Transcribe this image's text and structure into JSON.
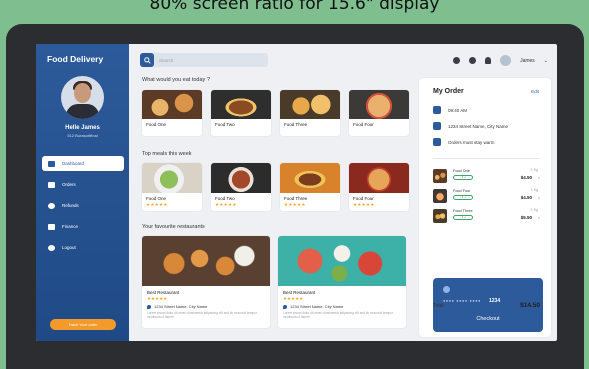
{
  "caption": "80% screen ratio for 15.6\" display",
  "sidebar": {
    "brand": "Food Delivery",
    "user_name": "Helle James",
    "user_sub": "512 Burasortfinal",
    "nav": [
      {
        "label": "Dashboard",
        "icon": "dashboard-icon"
      },
      {
        "label": "Orders",
        "icon": "orders-icon"
      },
      {
        "label": "Refunds",
        "icon": "refunds-icon"
      },
      {
        "label": "Finance",
        "icon": "finance-icon"
      },
      {
        "label": "Logout",
        "icon": "logout-icon"
      }
    ],
    "cta_label": "Track Your order"
  },
  "topbar": {
    "search_placeholder": "Search",
    "user_name": "James"
  },
  "sections": {
    "eat_title": "What would you eat today ?",
    "top_title": "Top meals this week",
    "fav_title": "Your favourite restaurants"
  },
  "eat_cards": [
    {
      "name": "Food One"
    },
    {
      "name": "Food Two"
    },
    {
      "name": "Food Three"
    },
    {
      "name": "Food Four"
    }
  ],
  "top_cards": [
    {
      "name": "Food One",
      "stars": "★★★★★"
    },
    {
      "name": "Food Two",
      "stars": "★★★★★"
    },
    {
      "name": "Food Three",
      "stars": "★★★★★"
    },
    {
      "name": "Food Four",
      "stars": "★★★★★"
    }
  ],
  "restaurants": [
    {
      "name": "Best Restaurant",
      "stars": "★★★★★",
      "address": "1234 Street Name, City Name",
      "desc": "Lorem ipsum dolor sit amet consectetur adipiscing elit sed do eiusmod tempor incididunt ut labore"
    },
    {
      "name": "Best Restaurant",
      "stars": "★★★★★",
      "address": "1234 Street Name, City Name",
      "desc": "Lorem ipsum dolor sit amet consectetur adipiscing elit sed do eiusmod tempor incididunt ut labore"
    }
  ],
  "order": {
    "title": "My Order",
    "edit": "Edit",
    "time": "09:40 AM",
    "address": "1234 Street Name, City Name",
    "note": "Orders must stay warm",
    "items": [
      {
        "name": "Food One",
        "qty": "- 1 +",
        "weight": "1 Kg",
        "price": "$4.50"
      },
      {
        "name": "Food Four",
        "qty": "- 1 +",
        "weight": "1 Kg",
        "price": "$4.50"
      },
      {
        "name": "Food Three",
        "qty": "- 1 +",
        "weight": "1 Kg",
        "price": "$5.50"
      }
    ],
    "card": {
      "masked": "●●●● ●●●● ●●●●",
      "last4": "1234",
      "holder_label": "CARD HOLDER",
      "holder": "ILLEANA",
      "exp_label": "EXP",
      "exp": "12/24",
      "cvv_label": "CVV",
      "cvv": "123"
    },
    "total_label": "Total",
    "total": "$14.50",
    "checkout": "Checkout"
  }
}
